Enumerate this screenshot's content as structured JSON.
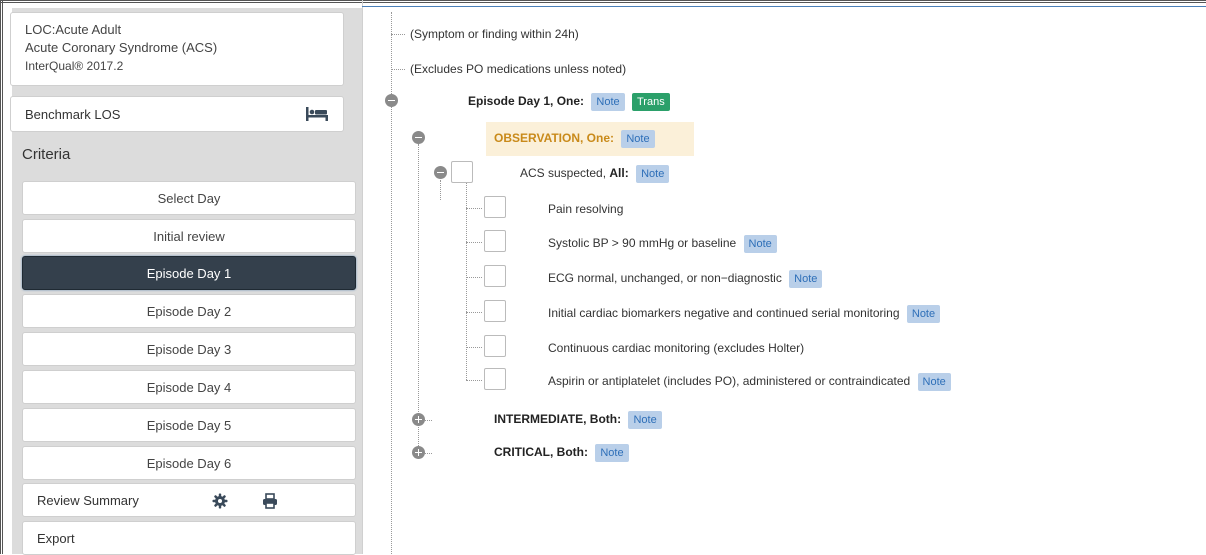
{
  "sidebar": {
    "loc_lines": [
      "LOC:Acute Adult",
      "Acute Coronary Syndrome (ACS)",
      "InterQual® 2017.2"
    ],
    "benchmark_label": "Benchmark LOS",
    "criteria_header": "Criteria",
    "select_day": "Select Day",
    "days": [
      "Initial review",
      "Episode Day 1",
      "Episode Day 2",
      "Episode Day 3",
      "Episode Day 4",
      "Episode Day 5",
      "Episode Day 6"
    ],
    "active_day": "Episode Day 1",
    "review_summary": "Review Summary",
    "export": "Export"
  },
  "tree": {
    "preamble": [
      "(Symptom or finding within 24h)",
      "(Excludes PO medications unless noted)"
    ],
    "episode": {
      "label": "Episode Day 1, One:",
      "note": "Note",
      "trans": "Trans"
    },
    "observation": {
      "label": "OBSERVATION, One:",
      "note": "Note"
    },
    "acs": {
      "label": "ACS suspected, ",
      "bold": "All:",
      "note": "Note"
    },
    "criteria": [
      {
        "text": "Pain resolving",
        "note": ""
      },
      {
        "text": "Systolic BP > 90 mmHg or baseline",
        "note": "Note"
      },
      {
        "text": "ECG normal, unchanged, or non−diagnostic",
        "note": "Note"
      },
      {
        "text": "Initial cardiac biomarkers negative and continued serial monitoring",
        "note": "Note"
      },
      {
        "text": "Continuous cardiac monitoring (excludes Holter)",
        "note": ""
      },
      {
        "text": "Aspirin or antiplatelet (includes PO), administered or contraindicated",
        "note": "Note"
      }
    ],
    "intermediate": {
      "label": "INTERMEDIATE, Both:",
      "note": "Note"
    },
    "critical": {
      "label": "CRITICAL, Both:",
      "note": "Note"
    }
  },
  "colors": {
    "note_bg": "#b9cfe9",
    "trans_bg": "#2ba06a",
    "active_nav": "#34404c",
    "sidebar_bg": "#dcdcdc"
  },
  "icons": {
    "benchmark": "bed-icon",
    "settings": "gear-icon",
    "print": "print-icon",
    "toggle": "collapse-expand-icon"
  }
}
